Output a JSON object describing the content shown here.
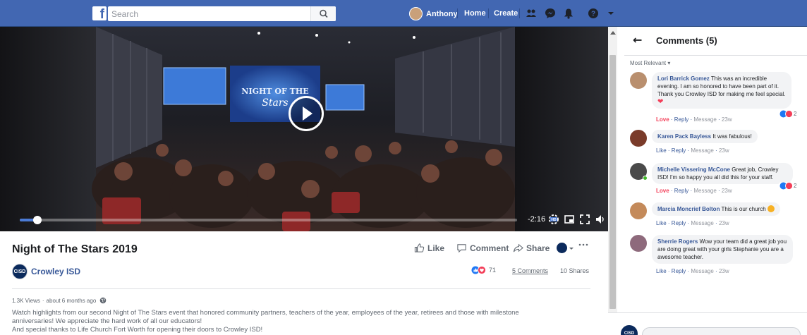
{
  "topbar": {
    "logo": "f",
    "search_placeholder": "Search",
    "user_name": "Anthony",
    "home_label": "Home",
    "create_label": "Create",
    "brand_color": "#4267b2"
  },
  "video": {
    "time_remaining": "-2:16",
    "progress": 0.035,
    "quality_badge": "HD"
  },
  "post": {
    "title": "Night of The Stars 2019",
    "actions": {
      "like_label": "Like",
      "comment_label": "Comment",
      "share_label": "Share"
    },
    "page_name": "Crowley ISD",
    "page_avatar_text": "CISD",
    "reaction_count": "71",
    "comments_link": "5 Comments",
    "shares": "10 Shares",
    "views": "1.3K Views",
    "time_ago": "about 6 months ago",
    "description": [
      "Watch highlights from our second Night of The Stars event that honored community partners, teachers of the year, employees of the year, retirees and those with milestone",
      "anniversaries! We appreciate the hard work of all our educators!",
      "And special thanks to Life Church Fort Worth for opening their doors to Crowley ISD!"
    ]
  },
  "panel": {
    "title": "Comments (5)",
    "sort_label": "Most Relevant",
    "comments": [
      {
        "author": "Lori Barrick Gomez",
        "text": "This was an incredible evening. I am so honored to have been part of it. Thank you Crowley ISD for making me feel special.",
        "reaction_label": "Love",
        "reply": "Reply",
        "message": "Message",
        "time": "23w",
        "react_count": "2",
        "avatar_color": "#b98f6e"
      },
      {
        "author": "Karen Pack Bayless",
        "text": "It was fabulous!",
        "reaction_label": "Like",
        "reply": "Reply",
        "message": "Message",
        "time": "23w",
        "avatar_color": "#7a3b2a"
      },
      {
        "author": "Michelle Vissering McCone",
        "text": "Great job, Crowley ISD! I'm so happy you all did this for your staff.",
        "reaction_label": "Love",
        "reply": "Reply",
        "message": "Message",
        "time": "23w",
        "react_count": "2",
        "avatar_color": "#4a4a4a"
      },
      {
        "author": "Marcia Moncrief Bolton",
        "text": "This is our church",
        "reaction_label": "Like",
        "reply": "Reply",
        "message": "Message",
        "time": "23w",
        "avatar_color": "#c48a5a"
      },
      {
        "author": "Sherrie Rogers",
        "text": "Wow your team did a great job you are doing great with your girls Stephanie you are a awesome teacher.",
        "reaction_label": "Like",
        "reply": "Reply",
        "message": "Message",
        "time": "23w",
        "avatar_color": "#8e6a7c"
      }
    ]
  }
}
